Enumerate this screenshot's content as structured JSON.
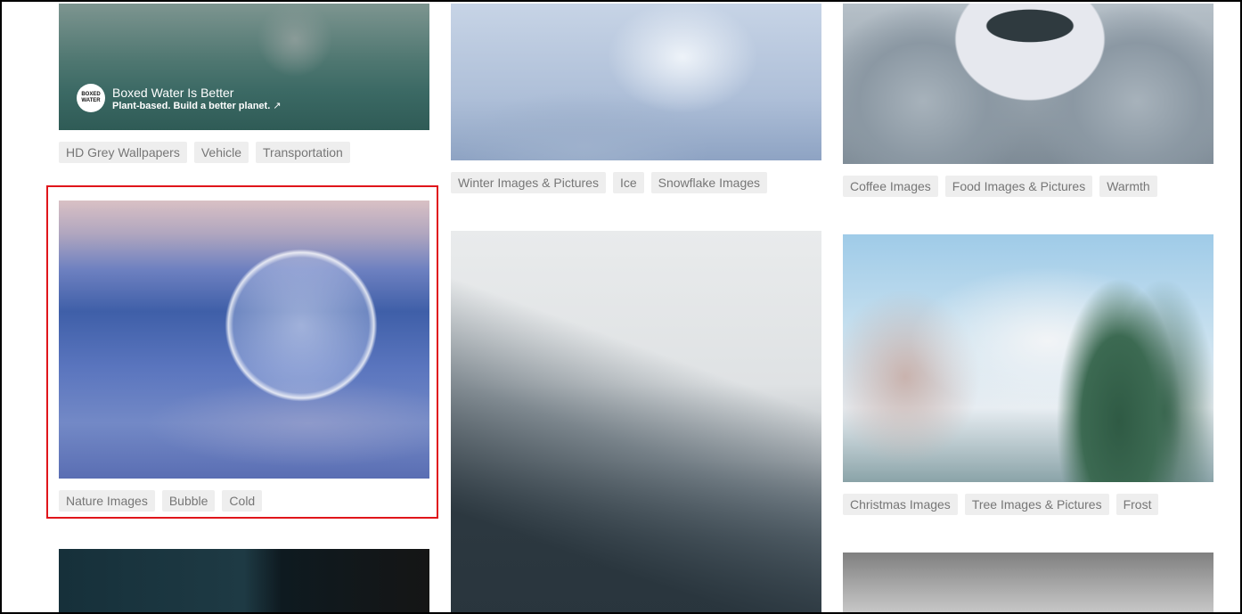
{
  "colors": {
    "highlight": "#e0151b",
    "tag_bg": "#eeeeee",
    "tag_text": "#767676"
  },
  "sponsor": {
    "logo_text": "BOXED WATER",
    "title": "Boxed Water Is Better",
    "subtitle": "Plant-based. Build a better planet.",
    "link_icon": "↗"
  },
  "columns": {
    "left": {
      "card1_tags": [
        "HD Grey Wallpapers",
        "Vehicle",
        "Transportation"
      ],
      "card2_tags": [
        "Nature Images",
        "Bubble",
        "Cold"
      ]
    },
    "middle": {
      "card1_tags": [
        "Winter Images & Pictures",
        "Ice",
        "Snowflake Images"
      ]
    },
    "right": {
      "card1_tags": [
        "Coffee Images",
        "Food Images & Pictures",
        "Warmth"
      ],
      "card2_tags": [
        "Christmas Images",
        "Tree Images & Pictures",
        "Frost"
      ]
    }
  }
}
